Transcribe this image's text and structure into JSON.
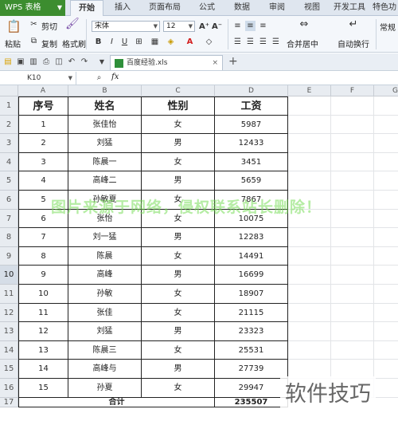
{
  "app": {
    "name": "WPS 表格",
    "tabs": [
      "开始",
      "插入",
      "页面布局",
      "公式",
      "数据",
      "审阅",
      "视图",
      "开发工具",
      "特色功"
    ],
    "active_tab": "开始",
    "accent": "#3c8d2f"
  },
  "ribbon": {
    "paste": "粘贴",
    "cut": "剪切",
    "copy": "复制",
    "format_painter": "格式刷",
    "font_name": "宋体",
    "font_size": "12",
    "merge_center": "合并居中",
    "auto_wrap": "自动换行",
    "general": "常规"
  },
  "file": {
    "tab_name": "百度经验.xls"
  },
  "formula_bar": {
    "name_box": "K10",
    "fx": "fx",
    "formula": ""
  },
  "sheet": {
    "columns": [
      "A",
      "B",
      "C",
      "D",
      "E",
      "F",
      "G"
    ],
    "row_numbers": [
      "1",
      "2",
      "3",
      "4",
      "5",
      "6",
      "7",
      "8",
      "9",
      "10",
      "11",
      "12",
      "13",
      "14",
      "15",
      "16",
      "17"
    ],
    "headers": [
      "序号",
      "姓名",
      "性别",
      "工资"
    ],
    "rows": [
      [
        "1",
        "张佳怡",
        "女",
        "5987"
      ],
      [
        "2",
        "刘猛",
        "男",
        "12433"
      ],
      [
        "3",
        "陈晨一",
        "女",
        "3451"
      ],
      [
        "4",
        "高峰二",
        "男",
        "5659"
      ],
      [
        "5",
        "孙敏夏",
        "女",
        "7867"
      ],
      [
        "6",
        "张怡",
        "女",
        "10075"
      ],
      [
        "7",
        "刘一猛",
        "男",
        "12283"
      ],
      [
        "8",
        "陈晨",
        "女",
        "14491"
      ],
      [
        "9",
        "高峰",
        "男",
        "16699"
      ],
      [
        "10",
        "孙敏",
        "女",
        "18907"
      ],
      [
        "11",
        "张佳",
        "女",
        "21115"
      ],
      [
        "12",
        "刘猛",
        "男",
        "23323"
      ],
      [
        "13",
        "陈晨三",
        "女",
        "25531"
      ],
      [
        "14",
        "高峰与",
        "男",
        "27739"
      ],
      [
        "15",
        "孙夏",
        "女",
        "29947"
      ]
    ],
    "total_label": "合计",
    "total_value": "235507",
    "selected_row": "10"
  },
  "overlay": {
    "watermark": "图片来源于网络，侵权联系站长删除！",
    "brand": "软件技巧"
  }
}
